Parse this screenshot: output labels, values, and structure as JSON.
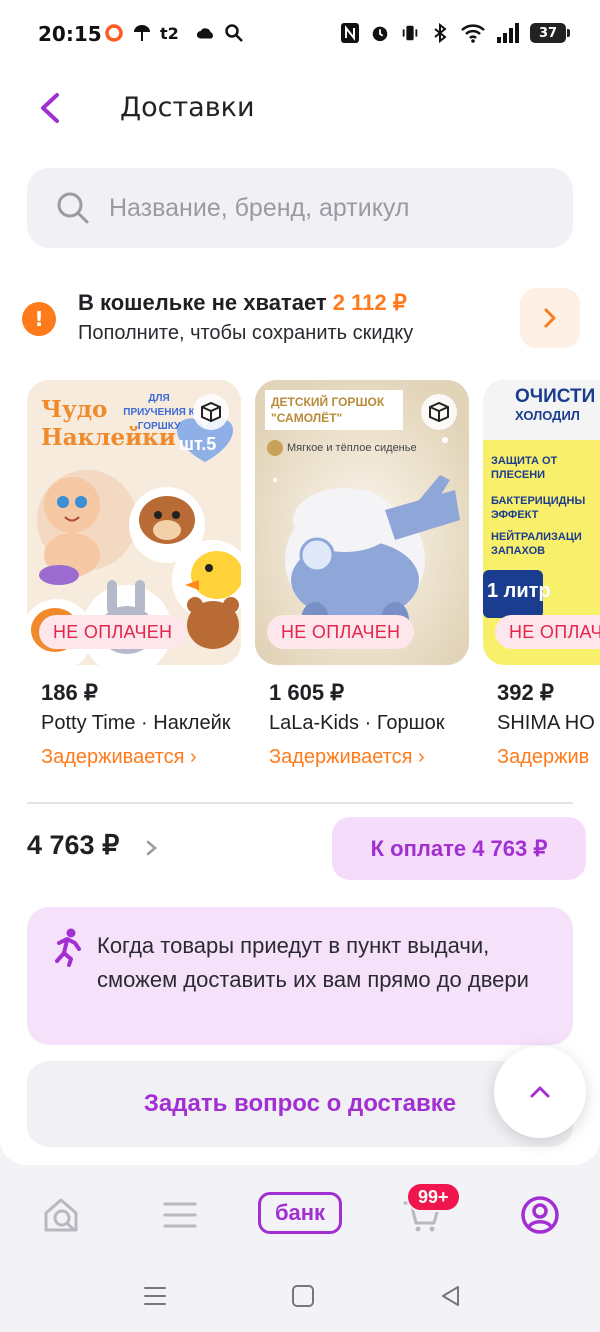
{
  "status_bar": {
    "time": "20:15",
    "battery": "37"
  },
  "header": {
    "title": "Доставки"
  },
  "search": {
    "placeholder": "Название, бренд, артикул"
  },
  "wallet": {
    "title_prefix": "В кошельке не хватает ",
    "amount": "2 112 ₽",
    "subtitle": "Пополните, чтобы сохранить скидку"
  },
  "products": [
    {
      "image_text": {
        "brand_title_line1": "Чудо",
        "brand_title_line2": "Наклейки",
        "tagline": "ДЛЯ ПРИУЧЕНИЯ К ГОРШКУ",
        "count": "шт.5"
      },
      "badge": "НЕ ОПЛАЧЕН",
      "price": "186 ₽",
      "name": "Potty Time · Наклейки",
      "status": "Задерживается ›"
    },
    {
      "image_text": {
        "title": "ДЕТСКИЙ ГОРШОК \"САМОЛЁТ\"",
        "feature": "Мягкое и тёплое сиденье"
      },
      "badge": "НЕ ОПЛАЧЕН",
      "price": "1 605 ₽",
      "name": "LaLa-Kids · Горшок",
      "status": "Задерживается ›"
    },
    {
      "image_text": {
        "title": "ОЧИСТИ",
        "subtitle": "ХОЛОДИЛ",
        "feature1": "ЗАЩИТА ОТ ПЛЕСЕНИ",
        "feature2": "БАКТЕРИЦИДНЫ ЭФФЕКТ",
        "feature3": "НЕЙТРАЛИЗАЦИ ЗАПАХОВ",
        "volume": "1 литр"
      },
      "badge": "НЕ ОПЛАЧ",
      "price": "392 ₽",
      "name": "SHIMA HO",
      "status": "Задержив"
    }
  ],
  "summary": {
    "total": "4 763 ₽",
    "pay_button": "К оплате 4 763 ₽"
  },
  "notice": {
    "text": "Когда товары приедут в пункт выдачи, сможем доставить их вам прямо до двери"
  },
  "ask_button": "Задать вопрос о доставке",
  "tabbar": {
    "bank_label": "банк",
    "cart_badge": "99+"
  },
  "colors": {
    "accent": "#a12fd1",
    "orange": "#ff7a1a",
    "unpaid_red": "#e5264a"
  }
}
